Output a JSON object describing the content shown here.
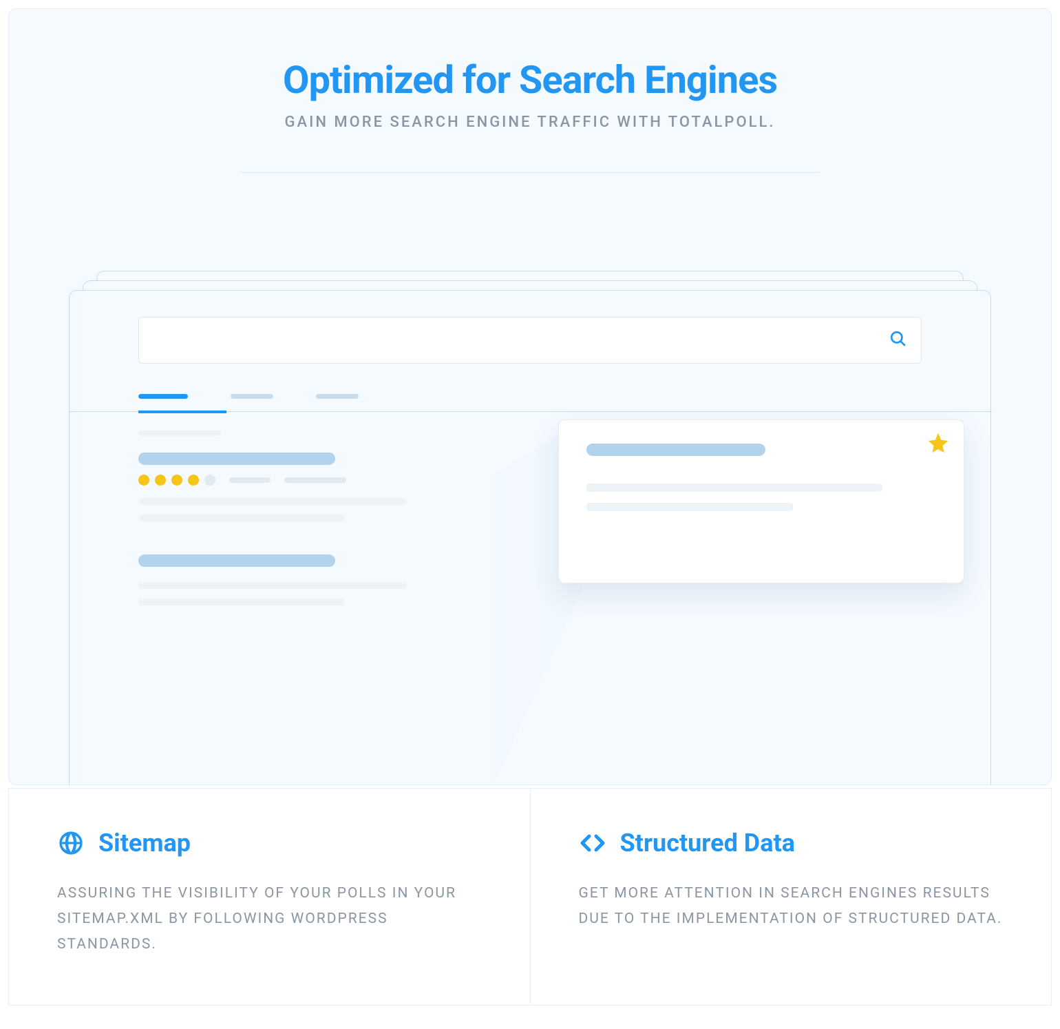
{
  "hero": {
    "title": "Optimized for Search Engines",
    "subtitle": "GAIN MORE SEARCH ENGINE TRAFFIC WITH TOTALPOLL."
  },
  "search": {
    "placeholder": ""
  },
  "illustration": {
    "rating_filled": 4,
    "rating_total": 5
  },
  "features": [
    {
      "icon": "globe-icon",
      "title": "Sitemap",
      "description": "ASSURING THE VISIBILITY OF YOUR POLLS IN YOUR SITEMAP.XML BY FOLLOWING WORDPRESS STANDARDS."
    },
    {
      "icon": "code-icon",
      "title": "Structured Data",
      "description": "GET MORE ATTENTION IN SEARCH ENGINES RESULTS DUE TO THE IMPLEMENTATION OF STRUCTURED DATA."
    }
  ],
  "colors": {
    "primary": "#2196f3",
    "muted": "#8a96a3",
    "panel": "#f5faff",
    "star": "#f5c517"
  }
}
